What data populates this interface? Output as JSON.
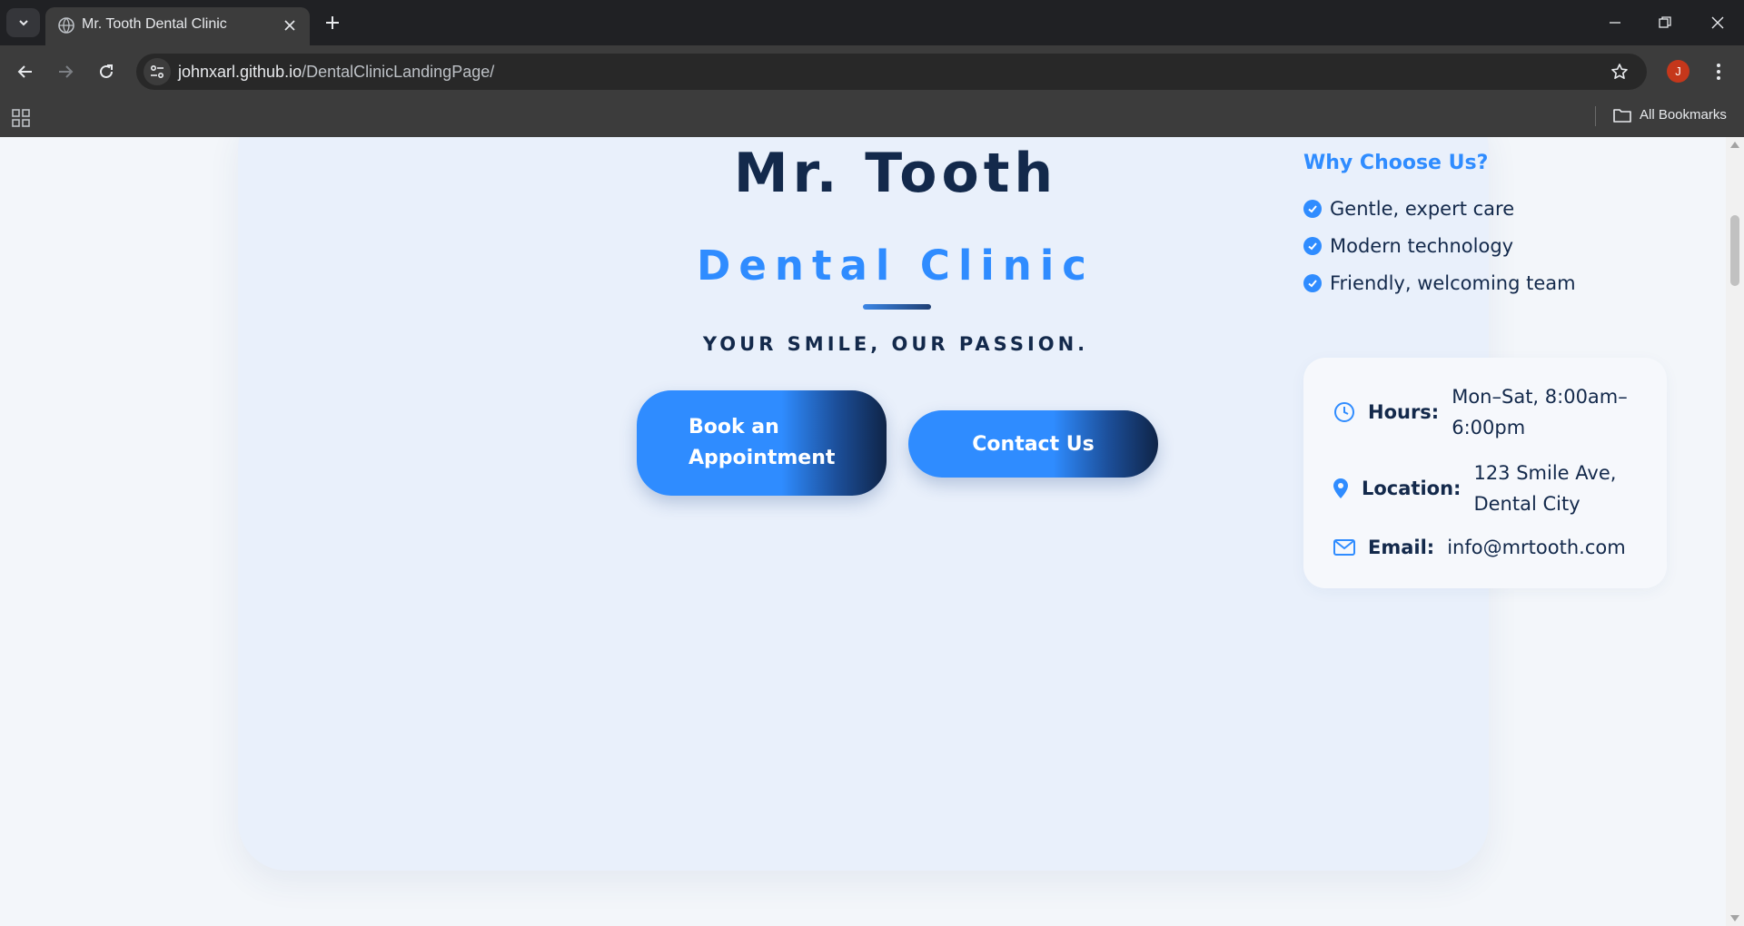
{
  "browser": {
    "tab_title": "Mr. Tooth Dental Clinic",
    "url_host": "johnxarl.github.io",
    "url_path": "/DentalClinicLandingPage/",
    "profile_initial": "J",
    "bookmarks_label": "All Bookmarks"
  },
  "hero": {
    "title": "Mr. Tooth",
    "subtitle": "Dental Clinic",
    "tagline": "YOUR SMILE, OUR PASSION.",
    "book_button_line1": "Book an",
    "book_button_line2": "Appointment",
    "contact_button": "Contact Us"
  },
  "why": {
    "title": "Why Choose Us?",
    "items": [
      "Gentle, expert care",
      "Modern technology",
      "Friendly, welcoming team"
    ]
  },
  "info": {
    "hours_label": "Hours:",
    "hours_line1": "Mon–Sat, 8:00am–",
    "hours_line2": "6:00pm",
    "location_label": "Location:",
    "location_line1": "123 Smile Ave,",
    "location_line2": "Dental City",
    "email_label": "Email:",
    "email_value": "info@mrtooth.com"
  },
  "colors": {
    "accent": "#2f8cff",
    "navy": "#13294b",
    "card_bg": "#e9f0fb",
    "page_bg": "#f3f6fa"
  },
  "icons": [
    "tab-search-icon",
    "globe-icon",
    "close-icon",
    "plus-icon",
    "minimize-icon",
    "restore-icon",
    "back-icon",
    "forward-icon",
    "reload-icon",
    "site-info-icon",
    "star-icon",
    "kebab-icon",
    "apps-icon",
    "folder-icon",
    "check-icon",
    "clock-icon",
    "location-pin-icon",
    "mail-icon"
  ]
}
